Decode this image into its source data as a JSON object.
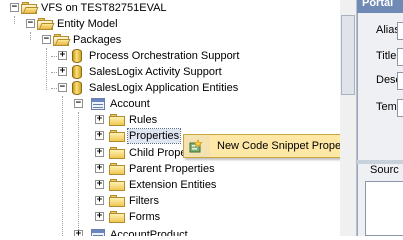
{
  "tree": {
    "items": [
      {
        "label": "VFS on TEST82751EVAL",
        "expander": "−",
        "icon": "folder-open-icon"
      },
      {
        "label": "Entity Model",
        "expander": "−",
        "icon": "folder-open-icon"
      },
      {
        "label": "Packages",
        "expander": "−",
        "icon": "folder-open-icon"
      },
      {
        "label": "Process Orchestration Support",
        "expander": "+",
        "icon": "package-cylinder-icon"
      },
      {
        "label": "SalesLogix Activity Support",
        "expander": "+",
        "icon": "package-cylinder-icon"
      },
      {
        "label": "SalesLogix Application Entities",
        "expander": "−",
        "icon": "package-cylinder-icon"
      },
      {
        "label": "Account",
        "expander": "−",
        "icon": "entity-table-icon"
      },
      {
        "label": "Rules",
        "expander": "+",
        "icon": "folder-icon"
      },
      {
        "label": "Properties",
        "expander": "+",
        "icon": "folder-icon",
        "selected": true
      },
      {
        "label": "Child Prope",
        "expander": "+",
        "icon": "folder-icon"
      },
      {
        "label": "Parent Properties",
        "expander": "+",
        "icon": "folder-icon"
      },
      {
        "label": "Extension Entities",
        "expander": "+",
        "icon": "folder-icon"
      },
      {
        "label": "Filters",
        "expander": "+",
        "icon": "folder-icon"
      },
      {
        "label": "Forms",
        "expander": "+",
        "icon": "folder-icon"
      },
      {
        "label": "AccountProduct",
        "expander": "+",
        "icon": "entity-table-icon"
      }
    ]
  },
  "context_menu": {
    "items": [
      {
        "label": "New Code Snippet Property",
        "icon": "code-snippet-icon"
      }
    ]
  },
  "right_panel": {
    "header": "Portal",
    "field_labels": [
      "Alias:",
      "Title:",
      "Desc",
      "Temp"
    ],
    "source_label": "Sourc"
  },
  "colors": {
    "menu_highlight": "#ffe8a6",
    "selection": "#dfe6f2",
    "panel_header": "#6f8ab5"
  }
}
